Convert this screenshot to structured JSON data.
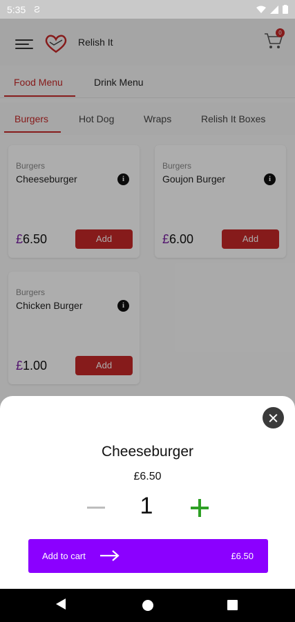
{
  "status_bar": {
    "time": "5:35"
  },
  "app_bar": {
    "brand": "Relish It",
    "cart_count": "0"
  },
  "menu_tabs": [
    {
      "label": "Food Menu"
    },
    {
      "label": "Drink Menu"
    }
  ],
  "category_tabs": [
    {
      "label": "Burgers"
    },
    {
      "label": "Hot Dog"
    },
    {
      "label": "Wraps"
    },
    {
      "label": "Relish It Boxes"
    }
  ],
  "products": [
    {
      "category": "Burgers",
      "name": "Cheeseburger",
      "currency": "£",
      "amount": "6.50",
      "add_label": "Add"
    },
    {
      "category": "Burgers",
      "name": "Goujon Burger",
      "currency": "£",
      "amount": "6.00",
      "add_label": "Add"
    },
    {
      "category": "Burgers",
      "name": "Chicken Burger",
      "currency": "£",
      "amount": "1.00",
      "add_label": "Add"
    }
  ],
  "sheet": {
    "title": "Cheeseburger",
    "price": "£6.50",
    "quantity": "1",
    "add_to_cart_label": "Add to cart",
    "total": "£6.50"
  },
  "colors": {
    "accent_red": "#c62828",
    "purple": "#8b00ff",
    "plus_green": "#2ea025"
  },
  "icons": [
    "menu-icon",
    "cart-icon",
    "info-icon",
    "close-icon",
    "minus-icon",
    "plus-icon",
    "arrow-right-icon",
    "back-icon",
    "home-icon",
    "recents-icon"
  ]
}
